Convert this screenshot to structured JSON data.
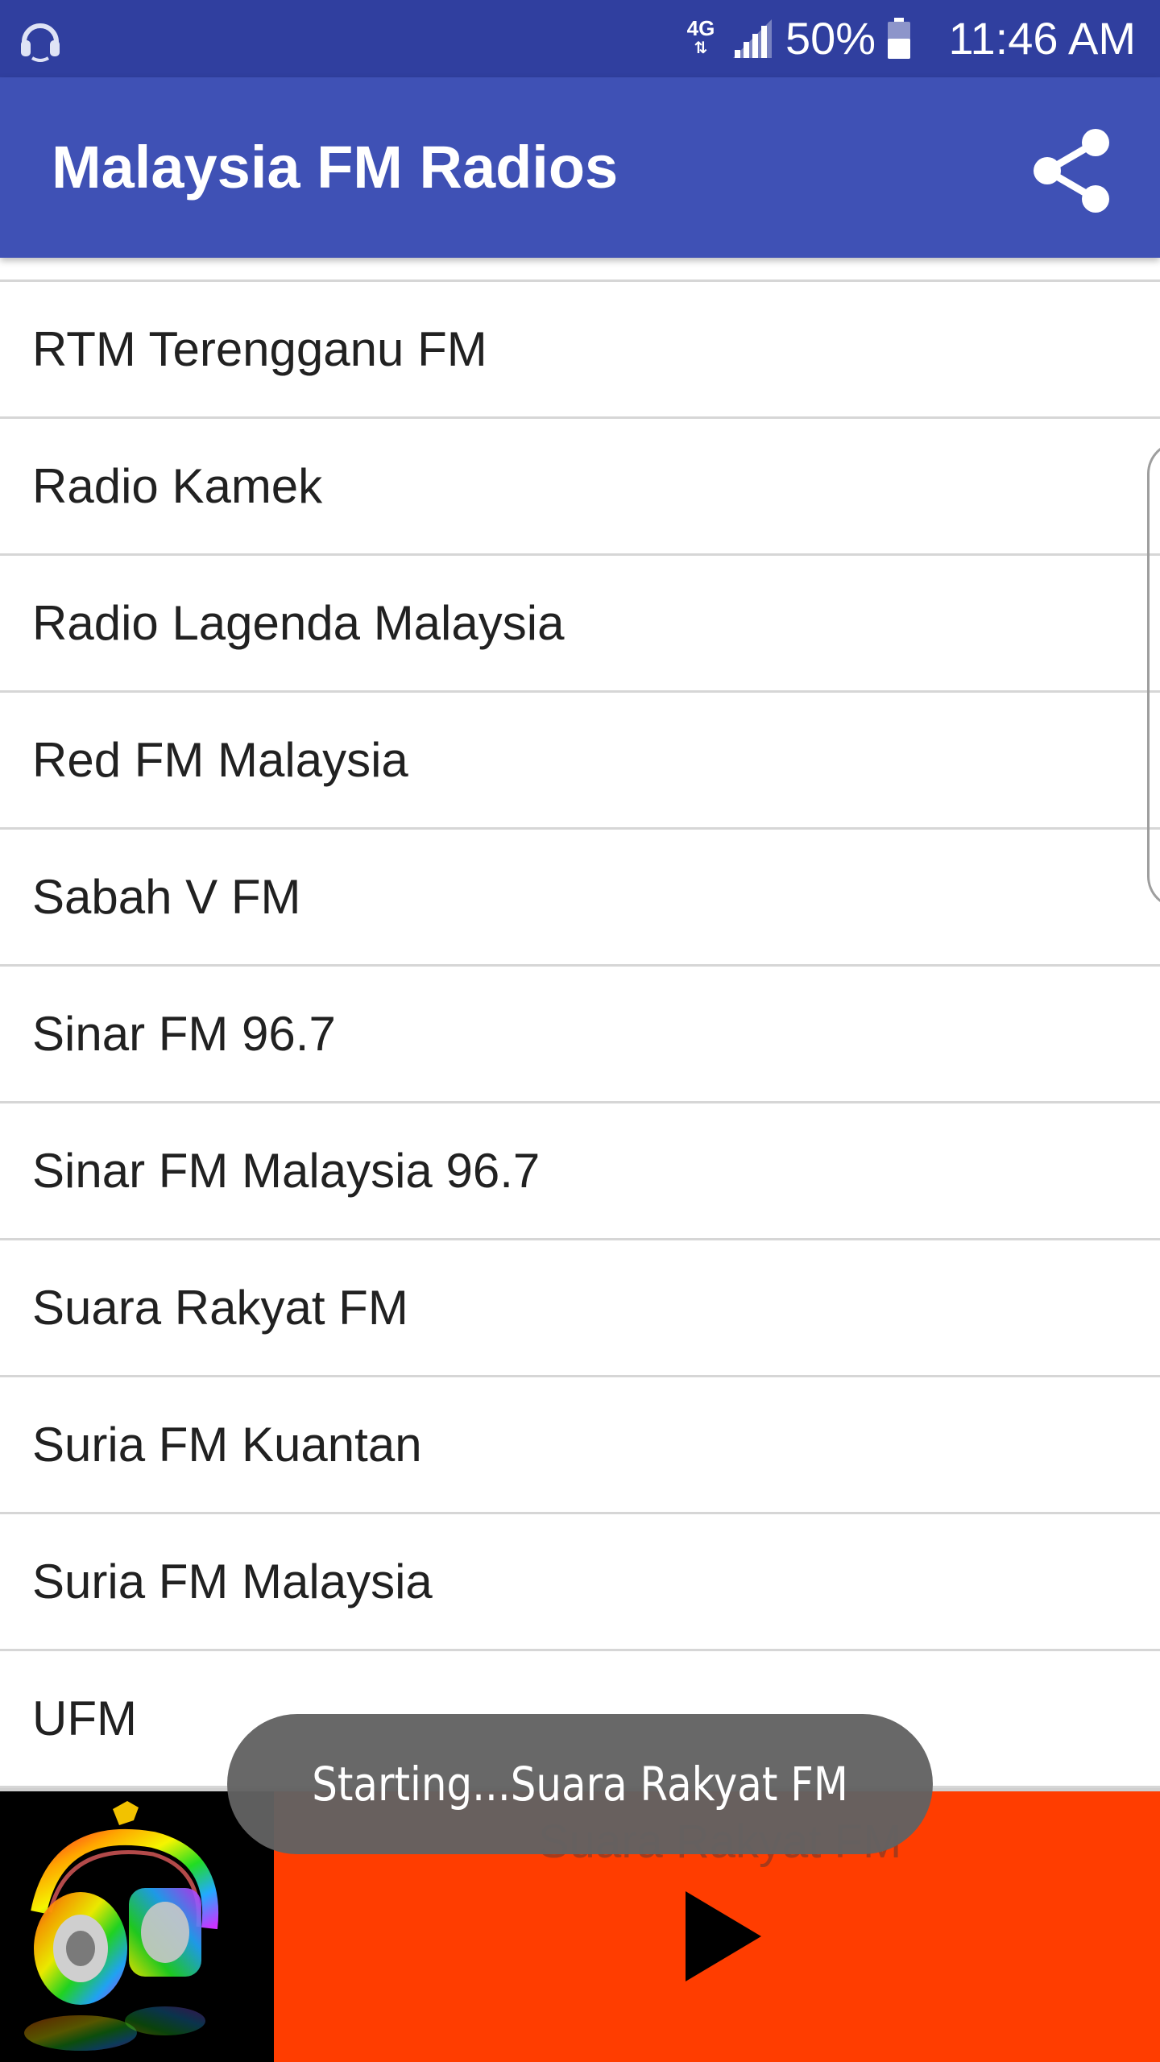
{
  "status_bar": {
    "network": "4G",
    "battery_percent": "50%",
    "time": "11:46 AM",
    "icons": [
      "headset-icon",
      "network-4g-icon",
      "signal-icon",
      "battery-icon"
    ],
    "background": "#303f9f"
  },
  "app_bar": {
    "title": "Malaysia FM Radios",
    "share_icon": "share-icon",
    "background": "#3f51b5"
  },
  "stations": [
    {
      "label": "RTM Terengganu FM"
    },
    {
      "label": "Radio Kamek"
    },
    {
      "label": "Radio Lagenda Malaysia"
    },
    {
      "label": "Red FM Malaysia"
    },
    {
      "label": "Sabah V FM"
    },
    {
      "label": "Sinar FM 96.7"
    },
    {
      "label": "Sinar FM Malaysia 96.7"
    },
    {
      "label": "Suara Rakyat FM"
    },
    {
      "label": "Suria FM Kuantan"
    },
    {
      "label": "Suria FM Malaysia"
    },
    {
      "label": "UFM"
    }
  ],
  "player": {
    "station_name": "Suara Rakyat FM",
    "artwork_icon": "headphones-art",
    "play_icon": "play-icon",
    "background": "#ff3d00"
  },
  "toast": {
    "message": "Starting...Suara Rakyat FM"
  }
}
